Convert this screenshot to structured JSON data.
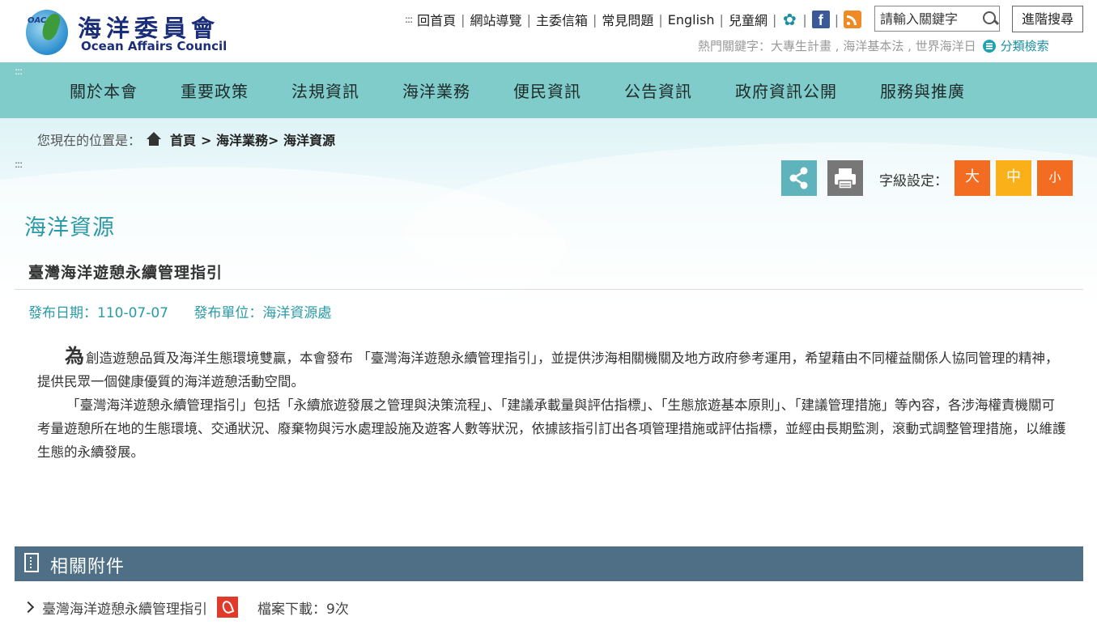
{
  "header": {
    "logo_zh": "海洋委員會",
    "logo_en": "Ocean Affairs Council",
    "logo_mark": "OAC",
    "accesskey": ":::",
    "top_links": [
      "回首頁",
      "網站導覽",
      "主委信箱",
      "常見問題",
      "English",
      "兒童網"
    ],
    "search_placeholder": "請輸入關鍵字",
    "advanced_search": "進階搜尋",
    "hot_keywords_label": "熱門關鍵字：",
    "hot_keywords": "大專生計畫 , 海洋基本法 , 世界海洋日",
    "category_search": "分類檢索"
  },
  "nav": {
    "accesskey": ":::",
    "items": [
      "關於本會",
      "重要政策",
      "法規資訊",
      "海洋業務",
      "便民資訊",
      "公告資訊",
      "政府資訊公開",
      "服務與推廣"
    ]
  },
  "breadcrumb": {
    "label": "您現在的位置是：",
    "home": "首頁",
    "trail": "> 海洋業務> 海洋資源",
    "accesskey": ":::"
  },
  "tools": {
    "font_size_label": "字級設定：",
    "font_sizes": [
      {
        "label": "大",
        "color": "#f26c22"
      },
      {
        "label": "中",
        "color": "#f9b019"
      },
      {
        "label": "小",
        "color": "#f26c22"
      }
    ],
    "share_color": "#5fb3bc",
    "print_color": "#777777"
  },
  "article": {
    "section": "海洋資源",
    "title": "臺灣海洋遊憩永續管理指引",
    "date": "發布日期：110-07-07",
    "unit": "發布單位：海洋資源處",
    "dropcap": "為",
    "p1": "創造遊憩品質及海洋生態環境雙贏，本會發布 「臺灣海洋遊憩永續管理指引」，並提供涉海相關機關及地方政府參考運用，希望藉由不同權益關係人協同管理的精神，提供民眾一個健康優質的海洋遊憩活動空間。",
    "p2": "「臺灣海洋遊憩永續管理指引」包括「永續旅遊發展之管理與決策流程」、「建議承載量與評估指標」、「生態旅遊基本原則」、「建議管理措施」等內容，各涉海權責機關可考量遊憩所在地的生態環境、交通狀況、廢棄物與污水處理設施及遊客人數等狀況，依據該指引訂出各項管理措施或評估指標，並經由長期監測，滾動式調整管理措施，以維護生態的永續發展。"
  },
  "attachments": {
    "title": "相關附件",
    "files": [
      {
        "name": "臺灣海洋遊憩永續管理指引",
        "downloads": "檔案下載：9次"
      }
    ]
  }
}
